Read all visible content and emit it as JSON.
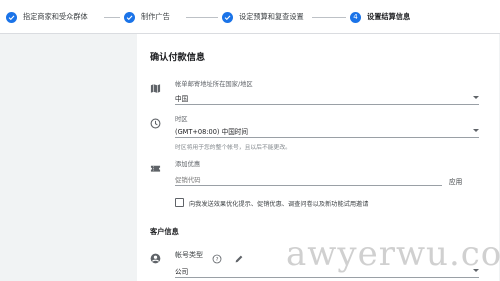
{
  "stepper": {
    "steps": [
      {
        "label": "指定商家和受众群体",
        "state": "done"
      },
      {
        "label": "制作广告",
        "state": "done"
      },
      {
        "label": "设定预算和复查设置",
        "state": "done"
      },
      {
        "label": "设置结算信息",
        "number": "4",
        "state": "active"
      }
    ]
  },
  "page": {
    "title": "确认付款信息",
    "billing_country": {
      "label": "帐单邮寄地址所在国家/地区",
      "value": "中国"
    },
    "timezone": {
      "label": "时区",
      "value": "(GMT+08:00) 中国时间",
      "helper": "时区将用于您的整个帐号，且以后不能更改。"
    },
    "promo": {
      "label": "添加优惠",
      "placeholder": "促销代码",
      "apply_label": "应用"
    },
    "opt_in": {
      "label": "向我发送效果优化提示、促销优惠、调查问卷以及新功能试用邀请",
      "checked": false
    },
    "customer_section": {
      "title": "客户信息",
      "account_type": {
        "label": "帐号类型",
        "value": "公司"
      }
    }
  },
  "watermark": "awyerwu.com",
  "colors": {
    "accent": "#1a73e8",
    "background": "#f1f3f4",
    "card": "#ffffff"
  }
}
